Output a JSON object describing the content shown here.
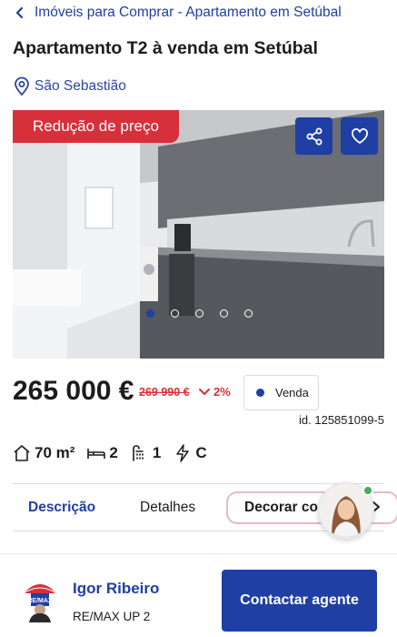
{
  "breadcrumb": {
    "label": "Imóveis para Comprar - Apartamento em Setúbal",
    "icon": "chevron-left-icon"
  },
  "listing": {
    "title": "Apartamento T2 à venda em Setúbal",
    "location": "São Sebastião",
    "badge": "Redução de preço",
    "price": "265 000 €",
    "old_price": "269 990 €",
    "price_drop": "2%",
    "business_type": "Venda",
    "listing_id": "id. 125851099-5",
    "gallery": {
      "total_images": 5,
      "active_index": 1
    }
  },
  "specs": [
    {
      "icon": "area-house-icon",
      "value": "70 m²"
    },
    {
      "icon": "bed-icon",
      "value": "2"
    },
    {
      "icon": "bath-icon",
      "value": "1"
    },
    {
      "icon": "energy-icon",
      "value": "C"
    }
  ],
  "tabs": {
    "description": "Descrição",
    "details": "Detalhes",
    "decorate": "Decorar com IA"
  },
  "agent": {
    "name": "Igor Ribeiro",
    "agency": "RE/MAX UP 2",
    "contact_label": "Contactar agente"
  },
  "colors": {
    "brand_blue": "#1f3fa5",
    "alert_red": "#d8303b",
    "online_green": "#3fae5b"
  }
}
